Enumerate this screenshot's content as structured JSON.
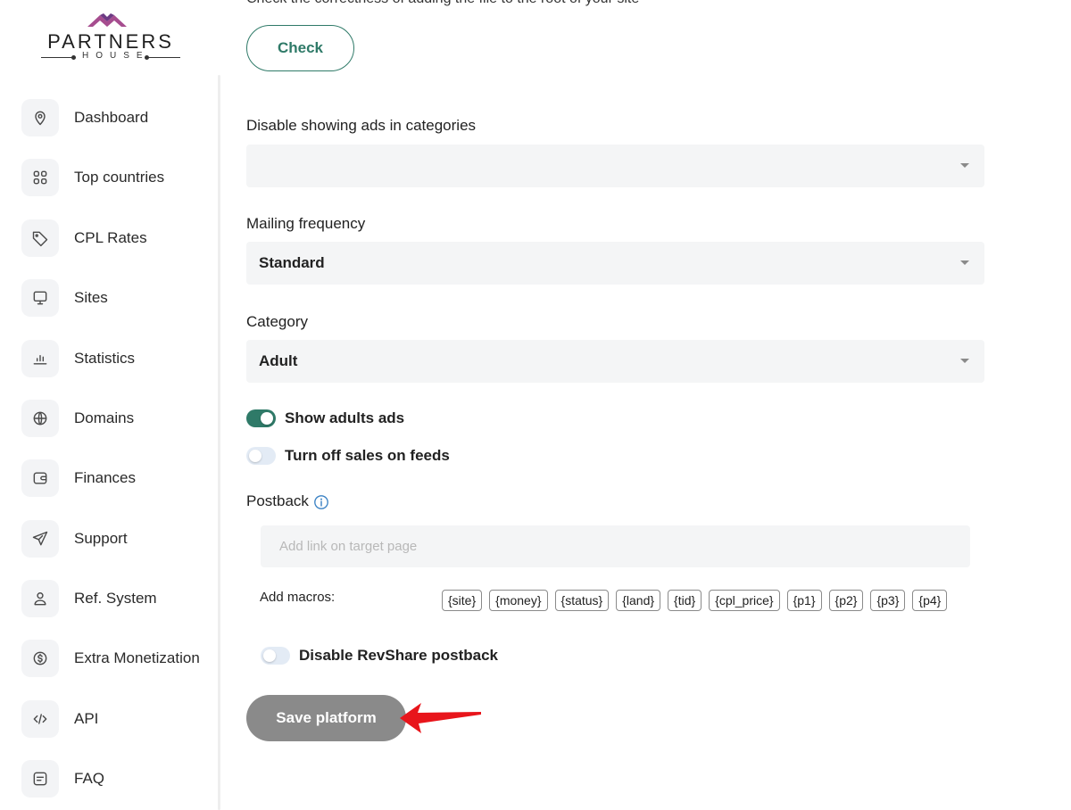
{
  "brand": {
    "name": "PARTNERS",
    "sub": "HOUSE",
    "accent": "#a64d8f"
  },
  "sidebar": {
    "items": [
      {
        "label": "Dashboard",
        "icon": "map-pin-icon"
      },
      {
        "label": "Top countries",
        "icon": "grid-icon"
      },
      {
        "label": "CPL Rates",
        "icon": "tag-icon"
      },
      {
        "label": "Sites",
        "icon": "monitor-icon"
      },
      {
        "label": "Statistics",
        "icon": "bar-chart-icon"
      },
      {
        "label": "Domains",
        "icon": "globe-icon"
      },
      {
        "label": "Finances",
        "icon": "wallet-icon"
      },
      {
        "label": "Support",
        "icon": "paper-plane-icon"
      },
      {
        "label": "Ref. System",
        "icon": "user-icon"
      },
      {
        "label": "Extra Monetization",
        "icon": "dollar-circle-icon"
      },
      {
        "label": "API",
        "icon": "code-icon"
      },
      {
        "label": "FAQ",
        "icon": "message-square-icon"
      }
    ]
  },
  "main": {
    "cut_text": "Check the correctness of adding the file to the root of your site",
    "check_button": "Check",
    "disable_ads": {
      "label": "Disable showing ads in categories",
      "value": ""
    },
    "mailing_frequency": {
      "label": "Mailing frequency",
      "value": "Standard"
    },
    "category": {
      "label": "Category",
      "value": "Adult"
    },
    "toggles": {
      "show_adult_ads": {
        "label": "Show adults ads",
        "on": true
      },
      "turn_off_sales": {
        "label": "Turn off sales on feeds",
        "on": false
      },
      "disable_revshare": {
        "label": "Disable RevShare postback",
        "on": false
      }
    },
    "postback": {
      "label": "Postback",
      "placeholder": "Add link on target page",
      "macros_label": "Add macros:",
      "macros": [
        "{site}",
        "{money}",
        "{status}",
        "{land}",
        "{tid}",
        "{cpl_price}",
        "{p1}",
        "{p2}",
        "{p3}",
        "{p4}"
      ]
    },
    "save_button": "Save platform"
  },
  "colors": {
    "primary": "#2f7a68",
    "button_disabled": "#8a8a8a",
    "annotation_arrow": "#e8151b"
  }
}
